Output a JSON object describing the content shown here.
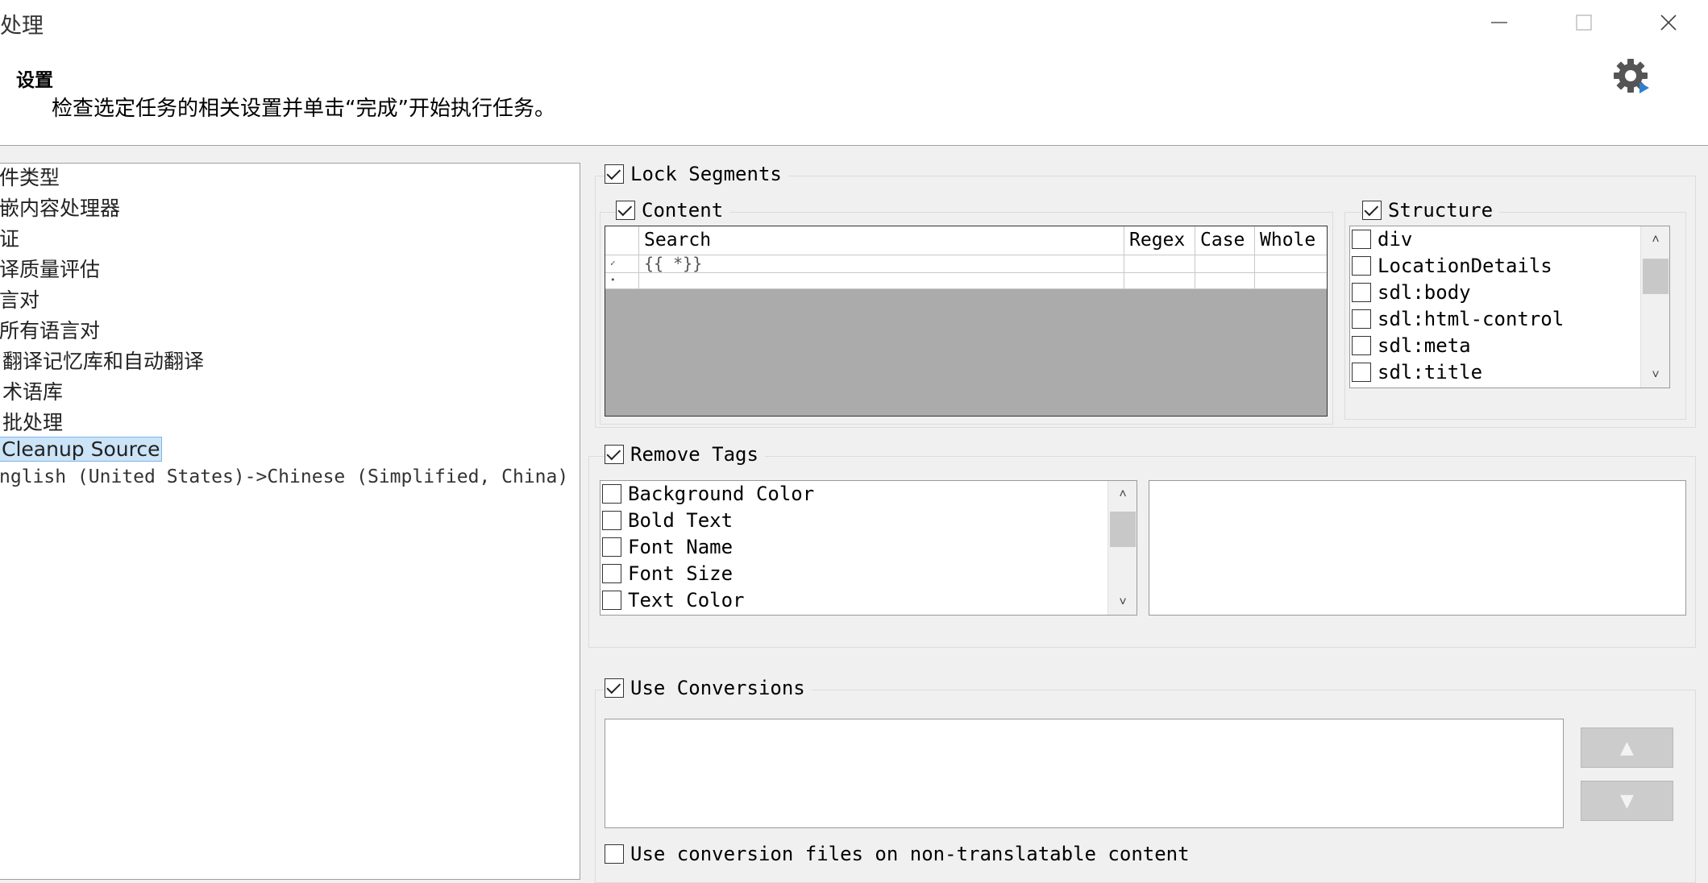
{
  "window": {
    "title": "处理"
  },
  "header": {
    "title": "设置",
    "description": "检查选定任务的相关设置并单击“完成”开始执行任务。"
  },
  "tree": {
    "items": [
      {
        "label": "件类型"
      },
      {
        "label": "嵌内容处理器"
      },
      {
        "label": "证"
      },
      {
        "label": "译质量评估"
      },
      {
        "label": "言对"
      },
      {
        "label": "所有语言对"
      },
      {
        "label": "翻译记忆库和自动翻译"
      },
      {
        "label": "术语库"
      },
      {
        "label": "批处理"
      },
      {
        "label": "Cleanup Source",
        "selected": true
      },
      {
        "label": "nglish (United States)->Chinese (Simplified, China)"
      }
    ]
  },
  "lock_segments": {
    "label": "Lock Segments",
    "checked": true,
    "content": {
      "label": "Content",
      "checked": true,
      "columns": [
        "Search",
        "Regex",
        "Case",
        "Whole"
      ],
      "rows": [
        {
          "indicator": "✓",
          "search": "{{ *}}",
          "regex": "",
          "case": "",
          "whole": ""
        },
        {
          "indicator": "•",
          "search": "",
          "regex": "",
          "case": "",
          "whole": ""
        }
      ]
    },
    "structure": {
      "label": "Structure",
      "checked": true,
      "items": [
        {
          "label": "div",
          "checked": false
        },
        {
          "label": "LocationDetails",
          "checked": false
        },
        {
          "label": "sdl:body",
          "checked": false
        },
        {
          "label": "sdl:html-control",
          "checked": false
        },
        {
          "label": "sdl:meta",
          "checked": false
        },
        {
          "label": "sdl:title",
          "checked": false
        }
      ]
    }
  },
  "remove_tags": {
    "label": "Remove Tags",
    "checked": true,
    "items": [
      {
        "label": "Background Color",
        "checked": false
      },
      {
        "label": "Bold Text",
        "checked": false
      },
      {
        "label": "Font Name",
        "checked": false
      },
      {
        "label": "Font Size",
        "checked": false
      },
      {
        "label": "Text Color",
        "checked": false
      }
    ]
  },
  "use_conversions": {
    "label": "Use Conversions",
    "checked": true,
    "up_glyph": "▲",
    "down_glyph": "▼",
    "non_translatable_label": "Use conversion files on non-translatable content",
    "non_translatable_checked": false
  },
  "glyphs": {
    "minimize": "—",
    "close": "✕",
    "scroll_up": "˄",
    "scroll_down": "˅"
  }
}
